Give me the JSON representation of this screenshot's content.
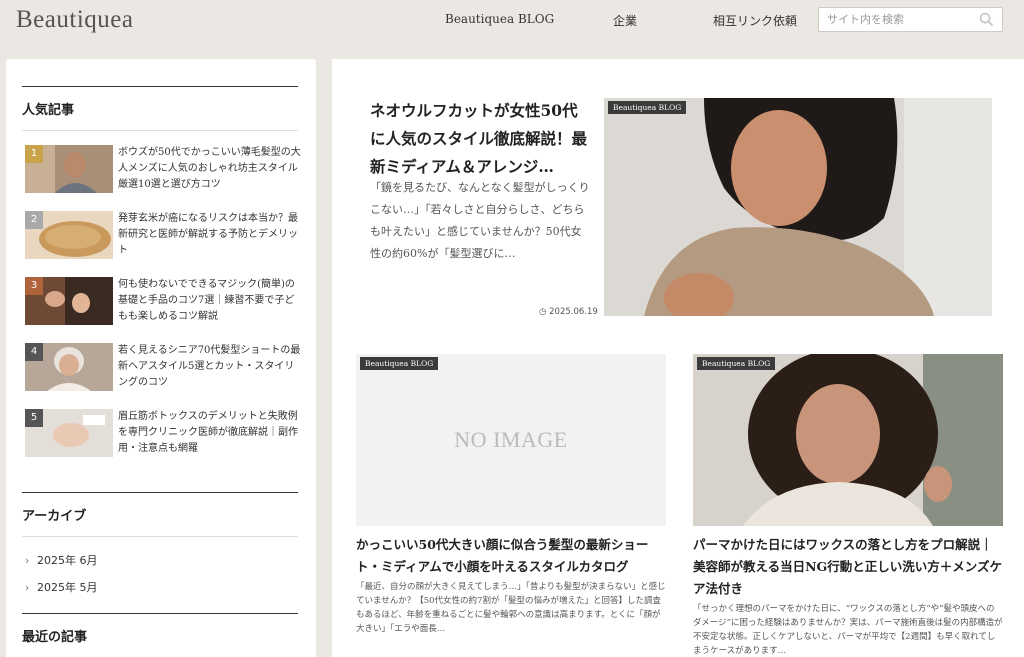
{
  "header": {
    "logo": "Beautiquea",
    "nav": [
      "Beautiquea BLOG",
      "企業",
      "相互リンク依頼"
    ],
    "search_placeholder": "サイト内を検索"
  },
  "sidebar": {
    "popular_title": "人気記事",
    "popular": [
      {
        "rank": "1",
        "text": "ボウズが50代でかっこいい薄毛髪型の大人メンズに人気のおしゃれ坊主スタイル厳選10選と選び方コツ"
      },
      {
        "rank": "2",
        "text": "発芽玄米が癌になるリスクは本当か？最新研究と医師が解説する予防とデメリット"
      },
      {
        "rank": "3",
        "text": "何も使わないでできるマジック(簡単)の基礎と手品のコツ7選｜練習不要で子どもも楽しめるコツ解説"
      },
      {
        "rank": "4",
        "text": "若く見えるシニア70代髪型ショートの最新ヘアスタイル5選とカット・スタイリングのコツ"
      },
      {
        "rank": "5",
        "text": "眉丘筋ボトックスのデメリットと失敗例を専門クリニック医師が徹底解説｜副作用・注意点も網羅"
      }
    ],
    "archive_title": "アーカイブ",
    "archives": [
      "2025年 6月",
      "2025年 5月"
    ],
    "recent_title": "最近の記事"
  },
  "main": {
    "featured": {
      "badge": "Beautiquea BLOG",
      "title": "ネオウルフカットが女性50代に人気のスタイル徹底解説！最新ミディアム＆アレンジ…",
      "excerpt": "「鏡を見るたび、なんとなく髪型がしっくりこない…」「若々しさと自分らしさ、どちらも叶えたい」と感じていませんか？50代女性の約60%が「髪型選びに…",
      "date": "2025.06.19"
    },
    "cards": [
      {
        "badge": "Beautiquea BLOG",
        "noimage": "NO IMAGE",
        "title": "かっこいい50代大きい顔に似合う髪型の最新ショート・ミディアムで小顔を叶えるスタイルカタログ",
        "excerpt": "「最近、自分の顔が大きく見えてしまう…」「昔よりも髪型が決まらない」と感じていませんか？【50代女性の約7割が「髪型の悩みが増えた」と回答】した調査もあるほど、年齢を重ねるごとに髪や輪郭への意識は高まります。とくに「顔が大きい」「エラや面長…"
      },
      {
        "badge": "Beautiquea BLOG",
        "title": "パーマかけた日にはワックスの落とし方をプロ解説｜美容師が教える当日NG行動と正しい洗い方＋メンズケア法付き",
        "excerpt": "「せっかく理想のパーマをかけた日に、“ワックスの落とし方”や“髪や頭皮へのダメージ”に困った経験はありませんか？実は、パーマ施術直後は髪の内部構造が不安定な状態。正しくケアしないと、パーマが平均で【2週間】も早く取れてしまうケースがあります…"
      }
    ]
  }
}
